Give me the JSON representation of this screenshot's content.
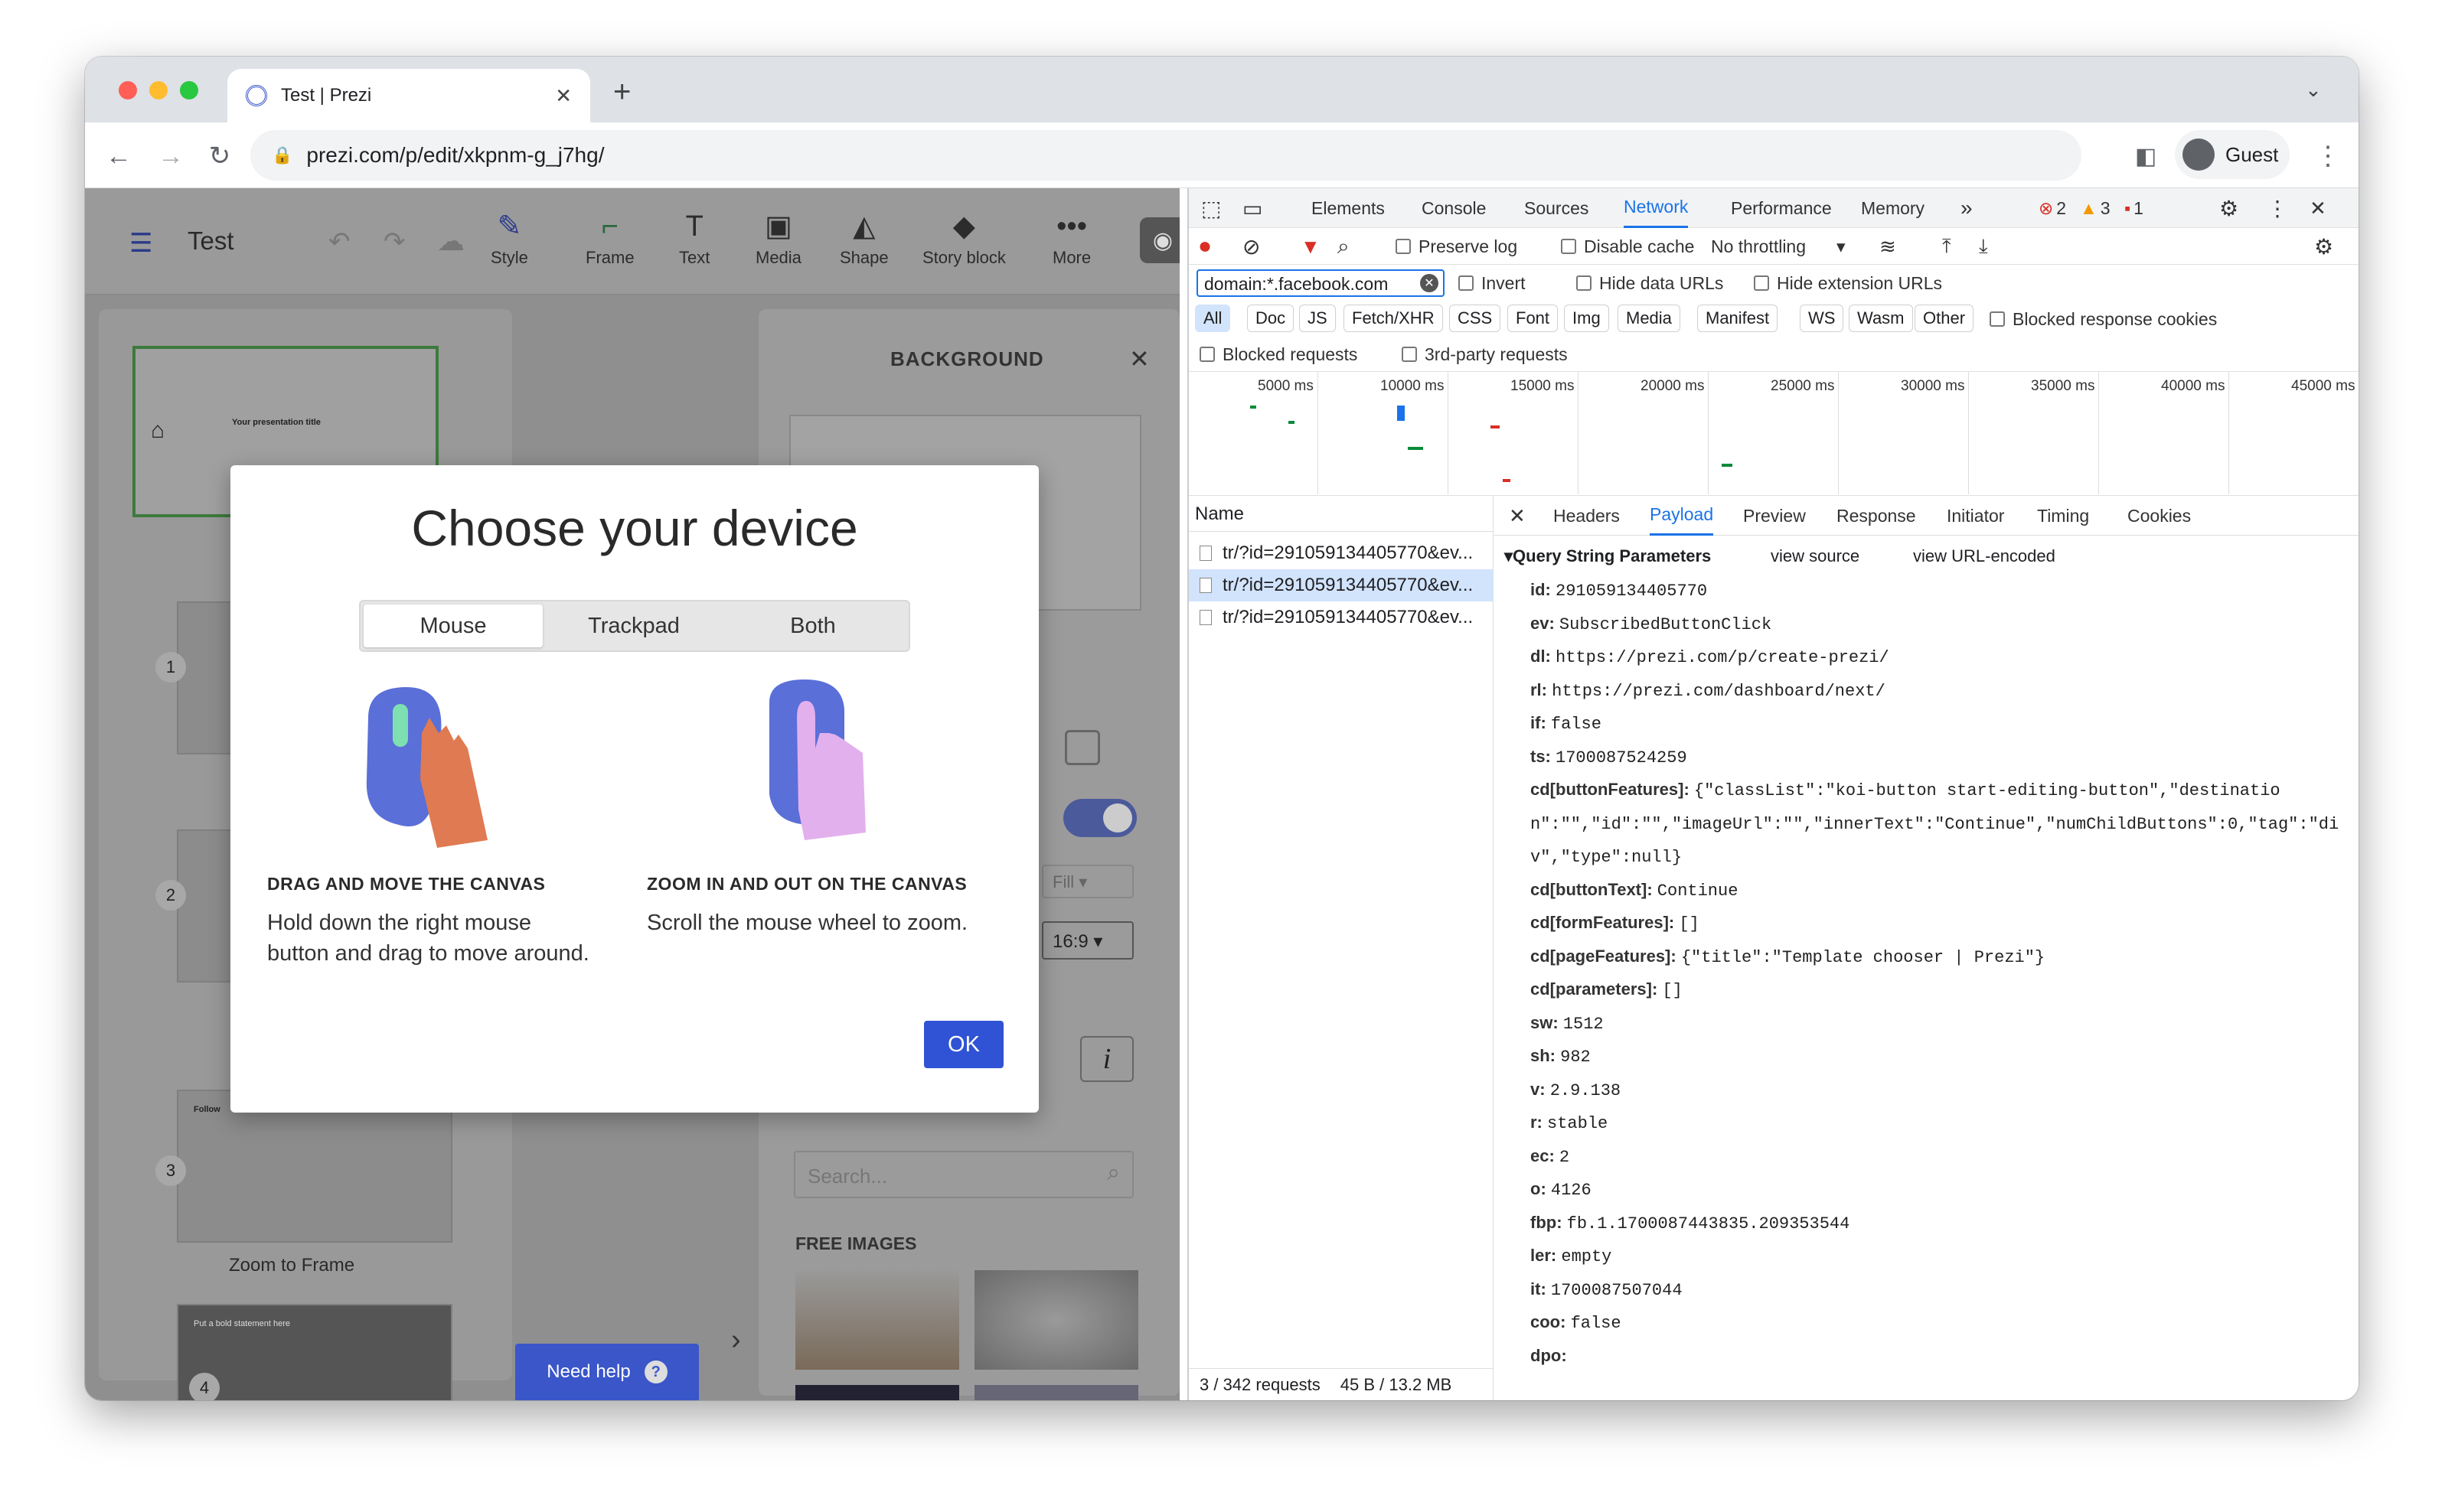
{
  "browser": {
    "tab_title": "Test | Prezi",
    "url": "prezi.com/p/edit/xkpnm-g_j7hg/",
    "profile": "Guest"
  },
  "prezi": {
    "title": "Test",
    "tools": [
      "Style",
      "Frame",
      "Text",
      "Media",
      "Shape",
      "Story block",
      "More"
    ],
    "thumb_title": "Your presentation title",
    "slide_numbers": [
      "1",
      "2",
      "3",
      "4"
    ],
    "zoom_label": "Zoom to Frame",
    "background_header": "BACKGROUND",
    "fill_label": "Fill",
    "ratio_label": "16:9",
    "search_placeholder": "Search...",
    "free_images": "FREE IMAGES",
    "need_help": "Need help",
    "slide3_text": "Follow",
    "slide4_text": "Put a bold statement here"
  },
  "modal": {
    "title": "Choose your device",
    "options": [
      "Mouse",
      "Trackpad",
      "Both"
    ],
    "selected": "Mouse",
    "left_heading": "DRAG AND MOVE THE CANVAS",
    "left_line1": "Hold down the right mouse",
    "left_line2": "button and drag to move around.",
    "right_heading": "ZOOM IN AND OUT ON THE CANVAS",
    "right_text": "Scroll the mouse wheel to zoom.",
    "ok": "OK"
  },
  "devtools": {
    "tabs": [
      "Elements",
      "Console",
      "Sources",
      "Network",
      "Performance",
      "Memory"
    ],
    "active_tab": "Network",
    "errors": "2",
    "warnings": "3",
    "issues": "1",
    "preserve_log": "Preserve log",
    "disable_cache": "Disable cache",
    "throttling": "No throttling",
    "filter_value": "domain:*.facebook.com",
    "invert": "Invert",
    "hide_data": "Hide data URLs",
    "hide_ext": "Hide extension URLs",
    "types": [
      "All",
      "Doc",
      "JS",
      "Fetch/XHR",
      "CSS",
      "Font",
      "Img",
      "Media",
      "Manifest",
      "WS",
      "Wasm",
      "Other"
    ],
    "blocked_cookies": "Blocked response cookies",
    "blocked_requests": "Blocked requests",
    "third_party": "3rd-party requests",
    "timeline": [
      "5000 ms",
      "10000 ms",
      "15000 ms",
      "20000 ms",
      "25000 ms",
      "30000 ms",
      "35000 ms",
      "40000 ms",
      "45000 ms"
    ],
    "name_header": "Name",
    "requests": [
      "tr/?id=291059134405770&ev...",
      "tr/?id=291059134405770&ev...",
      "tr/?id=291059134405770&ev..."
    ],
    "detail_tabs": [
      "Headers",
      "Payload",
      "Preview",
      "Response",
      "Initiator",
      "Timing",
      "Cookies"
    ],
    "active_detail": "Payload",
    "qsp_title": "Query String Parameters",
    "view_source": "view source",
    "view_url": "view URL-encoded",
    "params": [
      {
        "k": "id:",
        "v": "291059134405770"
      },
      {
        "k": "ev:",
        "v": "SubscribedButtonClick"
      },
      {
        "k": "dl:",
        "v": "https://prezi.com/p/create-prezi/"
      },
      {
        "k": "rl:",
        "v": "https://prezi.com/dashboard/next/"
      },
      {
        "k": "if:",
        "v": "false"
      },
      {
        "k": "ts:",
        "v": "1700087524259"
      },
      {
        "k": "cd[buttonFeatures]:",
        "v": "{\"classList\":\"koi-button start-editing-button\",\"destinatio"
      },
      {
        "k": "",
        "v": "n\":\"\",\"id\":\"\",\"imageUrl\":\"\",\"innerText\":\"Continue\",\"numChildButtons\":0,\"tag\":\"di"
      },
      {
        "k": "",
        "v": "v\",\"type\":null}"
      },
      {
        "k": "cd[buttonText]:",
        "v": "Continue"
      },
      {
        "k": "cd[formFeatures]:",
        "v": "[]"
      },
      {
        "k": "cd[pageFeatures]:",
        "v": "{\"title\":\"Template chooser | Prezi\"}"
      },
      {
        "k": "cd[parameters]:",
        "v": "[]"
      },
      {
        "k": "sw:",
        "v": "1512"
      },
      {
        "k": "sh:",
        "v": "982"
      },
      {
        "k": "v:",
        "v": "2.9.138"
      },
      {
        "k": "r:",
        "v": "stable"
      },
      {
        "k": "ec:",
        "v": "2"
      },
      {
        "k": "o:",
        "v": "4126"
      },
      {
        "k": "fbp:",
        "v": "fb.1.1700087443835.209353544"
      },
      {
        "k": "ler:",
        "v": "empty"
      },
      {
        "k": "it:",
        "v": "1700087507044"
      },
      {
        "k": "coo:",
        "v": "false"
      },
      {
        "k": "dpo:",
        "v": ""
      }
    ],
    "status_requests": "3 / 342 requests",
    "status_size": "45 B / 13.2 MB"
  },
  "colors": {
    "accent": "#1a73e8",
    "prezi_blue": "#3a56c9",
    "error": "#d93025",
    "warning": "#f29900"
  }
}
